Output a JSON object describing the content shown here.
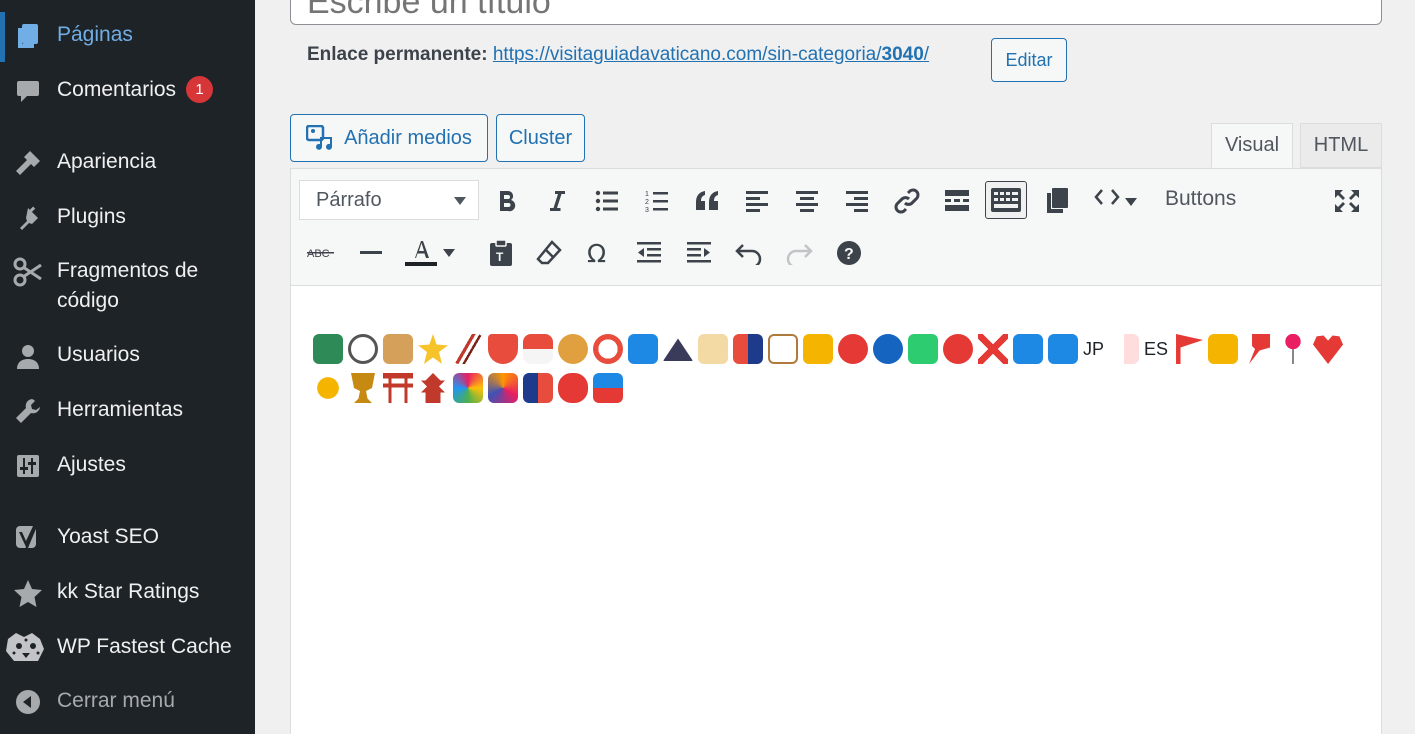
{
  "sidebar": {
    "items": [
      {
        "label": "Páginas",
        "icon": "pages-icon"
      },
      {
        "label": "Comentarios",
        "icon": "comments-icon",
        "badge": "1"
      },
      {
        "label": "Apariencia",
        "icon": "appearance-icon"
      },
      {
        "label": "Plugins",
        "icon": "plugins-icon"
      },
      {
        "label": "Fragmentos de",
        "label2": "código",
        "icon": "snippets-icon"
      },
      {
        "label": "Usuarios",
        "icon": "users-icon"
      },
      {
        "label": "Herramientas",
        "icon": "tools-icon"
      },
      {
        "label": "Ajustes",
        "icon": "settings-icon"
      },
      {
        "label": "Yoast SEO",
        "icon": "yoast-icon"
      },
      {
        "label": "kk Star Ratings",
        "icon": "star-icon"
      },
      {
        "label": "WP Fastest Cache",
        "icon": "cheetah-icon"
      }
    ],
    "collapse_label": "Cerrar menú"
  },
  "title": {
    "placeholder": "Escribe un título"
  },
  "permalink": {
    "label": "Enlace permanente:",
    "url_base": "https://visitaguiadavaticano.com/sin-categoria/",
    "slug": "3040",
    "url_end": "/",
    "edit_label": "Editar"
  },
  "media": {
    "add_label": "Añadir medios",
    "cluster_label": "Cluster"
  },
  "tabs": {
    "visual": "Visual",
    "html": "HTML"
  },
  "toolbar": {
    "format_value": "Párrafo",
    "buttons_label": "Buttons"
  },
  "content": {
    "text_items": {
      "jp": "JP",
      "es": "ES"
    }
  },
  "colors": {
    "sidebar_bg": "#1d2327",
    "accent": "#2271b1",
    "badge": "#d63638",
    "current_text": "#72aee6"
  }
}
